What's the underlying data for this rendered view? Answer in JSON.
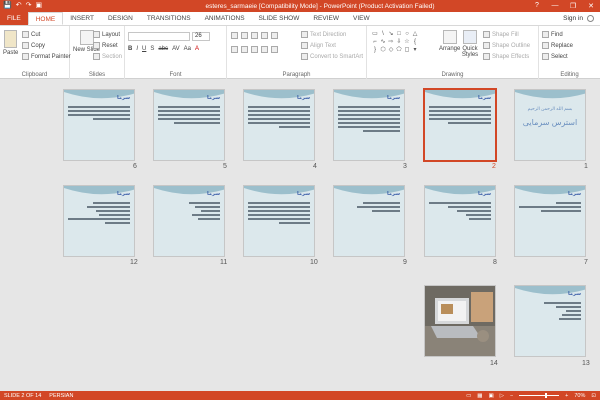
{
  "titlebar": {
    "title": "esteres_sarmaeie [Compatibility Mode] - PowerPoint (Product Activation Failed)",
    "qat": [
      "💾",
      "↶",
      "↷",
      "▣"
    ],
    "controls": [
      "?",
      "—",
      "❐",
      "✕"
    ]
  },
  "tabs": [
    "FILE",
    "HOME",
    "INSERT",
    "DESIGN",
    "TRANSITIONS",
    "ANIMATIONS",
    "SLIDE SHOW",
    "REVIEW",
    "VIEW"
  ],
  "signin": "Sign in",
  "ribbon": {
    "clipboard": {
      "paste": "Paste",
      "cut": "Cut",
      "copy": "Copy",
      "format_painter": "Format Painter",
      "label": "Clipboard"
    },
    "slides": {
      "new_slide": "New Slide",
      "layout": "Layout",
      "reset": "Reset",
      "section": "Section",
      "label": "Slides"
    },
    "font": {
      "size": "26",
      "label": "Font",
      "styles": [
        "B",
        "I",
        "U",
        "S",
        "abc",
        "AV",
        "Aa",
        "A"
      ]
    },
    "paragraph": {
      "text_direction": "Text Direction",
      "align_text": "Align Text",
      "convert_smartart": "Convert to SmartArt",
      "label": "Paragraph"
    },
    "drawing": {
      "arrange": "Arrange",
      "quick_styles": "Quick Styles",
      "shape_fill": "Shape Fill",
      "shape_outline": "Shape Outline",
      "shape_effects": "Shape Effects",
      "label": "Drawing"
    },
    "editing": {
      "find": "Find",
      "replace": "Replace",
      "select": "Select",
      "label": "Editing"
    }
  },
  "slides": [
    {
      "num": "1",
      "heading": "",
      "bismillah": "بسم الله الرحمن الرحیم",
      "bigtitle": "استرس سرمایی"
    },
    {
      "num": "2",
      "heading": "سرما",
      "selected": true
    },
    {
      "num": "3",
      "heading": "سرما"
    },
    {
      "num": "4",
      "heading": "سرما"
    },
    {
      "num": "5",
      "heading": "سرما"
    },
    {
      "num": "6",
      "heading": "سرما"
    },
    {
      "num": "7",
      "heading": "سرما"
    },
    {
      "num": "8",
      "heading": "سرما"
    },
    {
      "num": "9",
      "heading": "سرما"
    },
    {
      "num": "10",
      "heading": "سرما"
    },
    {
      "num": "11",
      "heading": "سرما"
    },
    {
      "num": "12",
      "heading": "سرما"
    },
    {
      "num": "13",
      "heading": "سرما"
    },
    {
      "num": "14",
      "heading": "",
      "photo": true
    }
  ],
  "status": {
    "slide_info": "SLIDE 2 OF 14",
    "language": "PERSIAN",
    "zoom": "70%"
  },
  "colors": {
    "accent": "#d24726",
    "slide_bg": "#dce8ec",
    "heading": "#3a5da8"
  }
}
